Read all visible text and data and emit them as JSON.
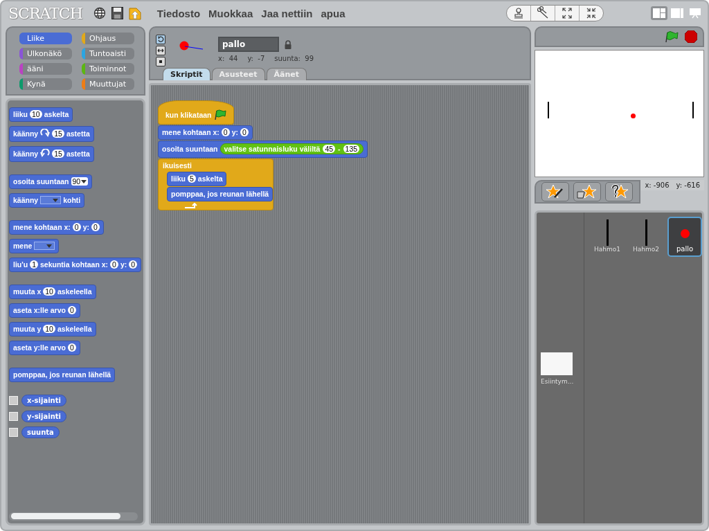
{
  "logo": "SCRATCH",
  "menu": [
    {
      "label": "Tiedosto"
    },
    {
      "label": "Muokkaa"
    },
    {
      "label": "Jaa nettiin"
    },
    {
      "label": "apua"
    }
  ],
  "layout_modes": [
    {
      "kind": "normal",
      "selected": true
    },
    {
      "kind": "small-stage",
      "selected": false
    },
    {
      "kind": "presentation",
      "selected": false
    }
  ],
  "categories": [
    {
      "label": "Liike",
      "color": "#4a6cd4",
      "selected": true
    },
    {
      "label": "Ohjaus",
      "color": "#e1a91a",
      "selected": false
    },
    {
      "label": "Ulkonäkö",
      "color": "#8a55d7",
      "selected": false
    },
    {
      "label": "Tuntoaisti",
      "color": "#2ca5e2",
      "selected": false
    },
    {
      "label": "ääni",
      "color": "#bb42c3",
      "selected": false
    },
    {
      "label": "Toiminnot",
      "color": "#5cb712",
      "selected": false
    },
    {
      "label": "Kynä",
      "color": "#0e9a6c",
      "selected": false
    },
    {
      "label": "Muuttujat",
      "color": "#ee7d16",
      "selected": false
    }
  ],
  "palette": {
    "groups": [
      [
        {
          "kind": "command",
          "parts": [
            {
              "kind": "text",
              "text": "liiku"
            },
            {
              "kind": "number",
              "text": "10"
            },
            {
              "kind": "text",
              "text": "askelta"
            }
          ]
        },
        {
          "kind": "command",
          "parts": [
            {
              "kind": "text",
              "text": "käänny"
            },
            {
              "kind": "turn-right"
            },
            {
              "kind": "number",
              "text": "15"
            },
            {
              "kind": "text",
              "text": "astetta"
            }
          ]
        },
        {
          "kind": "command",
          "parts": [
            {
              "kind": "text",
              "text": "käänny"
            },
            {
              "kind": "turn-left"
            },
            {
              "kind": "number",
              "text": "15"
            },
            {
              "kind": "text",
              "text": "astetta"
            }
          ]
        }
      ],
      [
        {
          "kind": "command",
          "parts": [
            {
              "kind": "text",
              "text": "osoita suuntaan"
            },
            {
              "kind": "dropdown",
              "text": "90"
            }
          ]
        },
        {
          "kind": "command",
          "parts": [
            {
              "kind": "text",
              "text": "käänny"
            },
            {
              "kind": "menu"
            },
            {
              "kind": "text",
              "text": "kohti"
            }
          ]
        }
      ],
      [
        {
          "kind": "command",
          "parts": [
            {
              "kind": "text",
              "text": "mene kohtaan x:"
            },
            {
              "kind": "number",
              "text": "0"
            },
            {
              "kind": "text",
              "text": "y:"
            },
            {
              "kind": "number",
              "text": "0"
            }
          ]
        },
        {
          "kind": "command",
          "parts": [
            {
              "kind": "text",
              "text": "mene"
            },
            {
              "kind": "menu"
            }
          ]
        },
        {
          "kind": "command",
          "parts": [
            {
              "kind": "text",
              "text": "liu'u"
            },
            {
              "kind": "number",
              "text": "1"
            },
            {
              "kind": "text",
              "text": "sekuntia kohtaan x:"
            },
            {
              "kind": "number",
              "text": "0"
            },
            {
              "kind": "text",
              "text": "y:"
            },
            {
              "kind": "number",
              "text": "0"
            }
          ]
        }
      ],
      [
        {
          "kind": "command",
          "parts": [
            {
              "kind": "text",
              "text": "muuta x"
            },
            {
              "kind": "number",
              "text": "10"
            },
            {
              "kind": "text",
              "text": "askeleella"
            }
          ]
        },
        {
          "kind": "command",
          "parts": [
            {
              "kind": "text",
              "text": "aseta x:lle arvo"
            },
            {
              "kind": "number",
              "text": "0"
            }
          ]
        },
        {
          "kind": "command",
          "parts": [
            {
              "kind": "text",
              "text": "muuta y"
            },
            {
              "kind": "number",
              "text": "10"
            },
            {
              "kind": "text",
              "text": "askeleella"
            }
          ]
        },
        {
          "kind": "command",
          "parts": [
            {
              "kind": "text",
              "text": "aseta y:lle arvo"
            },
            {
              "kind": "number",
              "text": "0"
            }
          ]
        }
      ],
      [
        {
          "kind": "command",
          "parts": [
            {
              "kind": "text",
              "text": "pomppaa, jos reunan lähellä"
            }
          ]
        }
      ]
    ],
    "reporters": [
      {
        "label": "x-sijainti",
        "checked": false
      },
      {
        "label": "y-sijainti",
        "checked": false
      },
      {
        "label": "suunta",
        "checked": false
      }
    ]
  },
  "rotation_styles": [
    {
      "kind": "rotate",
      "selected": true
    },
    {
      "kind": "flip",
      "selected": false
    },
    {
      "kind": "none",
      "selected": false
    }
  ],
  "sprite": {
    "name": "pallo",
    "readouts": [
      {
        "label": "x:",
        "value": "44"
      },
      {
        "label": "y:",
        "value": "-7"
      },
      {
        "label": "suunta:",
        "value": "99"
      }
    ]
  },
  "tabs": [
    {
      "label": "Skriptit",
      "selected": true
    },
    {
      "label": "Asusteet",
      "selected": false
    },
    {
      "label": "Äänet",
      "selected": false
    }
  ],
  "script": [
    {
      "kind": "hat",
      "parts": [
        {
          "kind": "text",
          "text": "kun klikataan"
        },
        {
          "kind": "flag"
        }
      ]
    },
    {
      "kind": "command",
      "parts": [
        {
          "kind": "text",
          "text": "mene kohtaan x:"
        },
        {
          "kind": "number",
          "text": "0"
        },
        {
          "kind": "text",
          "text": "y:"
        },
        {
          "kind": "number",
          "text": "0"
        }
      ]
    },
    {
      "kind": "command",
      "parts": [
        {
          "kind": "text",
          "text": "osoita suuntaan"
        },
        {
          "kind": "reporter",
          "parts": [
            {
              "kind": "text",
              "text": "valitse satunnaisluku väliltä"
            },
            {
              "kind": "number",
              "text": "45"
            },
            {
              "kind": "text",
              "text": "-"
            },
            {
              "kind": "number",
              "text": "135"
            }
          ]
        }
      ]
    },
    {
      "kind": "forever",
      "parts": [
        {
          "kind": "text",
          "text": "ikuisesti"
        }
      ],
      "children": [
        {
          "kind": "command",
          "parts": [
            {
              "kind": "text",
              "text": "liiku"
            },
            {
              "kind": "number",
              "text": "5"
            },
            {
              "kind": "text",
              "text": "askelta"
            }
          ]
        },
        {
          "kind": "command",
          "parts": [
            {
              "kind": "text",
              "text": "pomppaa, jos reunan lähellä"
            }
          ]
        }
      ]
    }
  ],
  "mouse_readouts": [
    {
      "label": "x:",
      "value": "-906"
    },
    {
      "label": "y:",
      "value": "-616"
    }
  ],
  "stage_thumb": {
    "label": "Esiintym..."
  },
  "sprites": [
    {
      "name": "Hahmo1",
      "kind": "line",
      "selected": false
    },
    {
      "name": "Hahmo2",
      "kind": "line",
      "selected": false
    },
    {
      "name": "pallo",
      "kind": "ball",
      "selected": true
    }
  ]
}
